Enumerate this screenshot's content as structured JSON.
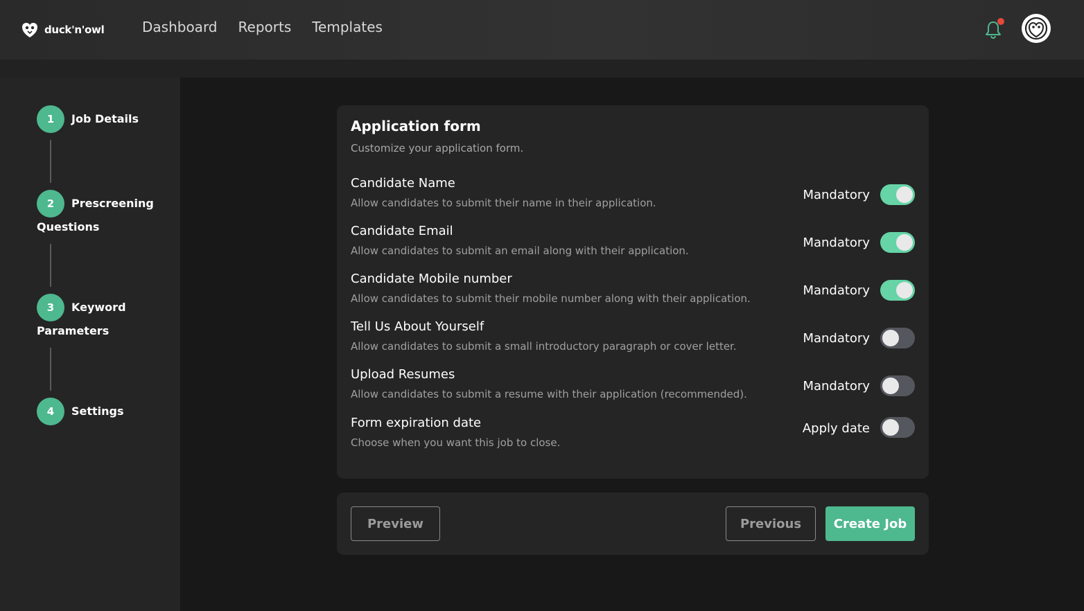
{
  "header": {
    "logo_text": "duck'n'owl",
    "nav": [
      "Dashboard",
      "Reports",
      "Templates"
    ]
  },
  "steps": [
    {
      "number": "1",
      "label": "Job Details"
    },
    {
      "number": "2",
      "label": "Prescreening Questions"
    },
    {
      "number": "3",
      "label": "Keyword Parameters"
    },
    {
      "number": "4",
      "label": "Settings"
    }
  ],
  "form": {
    "title": "Application form",
    "subtitle": "Customize your application form.",
    "fields": [
      {
        "title": "Candidate Name",
        "description": "Allow candidates to submit their name in their application.",
        "option_label": "Mandatory",
        "enabled": true
      },
      {
        "title": "Candidate Email",
        "description": "Allow candidates to submit an email along with their application.",
        "option_label": "Mandatory",
        "enabled": true
      },
      {
        "title": "Candidate Mobile number",
        "description": "Allow candidates to submit their mobile number along with their application.",
        "option_label": "Mandatory",
        "enabled": true
      },
      {
        "title": "Tell Us About Yourself",
        "description": "Allow candidates to submit a small introductory paragraph or cover letter.",
        "option_label": "Mandatory",
        "enabled": false
      },
      {
        "title": "Upload Resumes",
        "description": "Allow candidates to submit a resume with their application (recommended).",
        "option_label": "Mandatory",
        "enabled": false
      },
      {
        "title": "Form expiration date",
        "description": "Choose when you want this job to close.",
        "option_label": "Apply date",
        "enabled": false
      }
    ]
  },
  "actions": {
    "preview": "Preview",
    "previous": "Previous",
    "create": "Create Job"
  },
  "colors": {
    "accent": "#4eb88f",
    "toggle_on": "#66d4a6",
    "toggle_off": "#55575e",
    "notification_dot": "#e5483d"
  },
  "icons": {
    "bell": "bell-icon",
    "logo": "duck-owl-logo-icon",
    "avatar": "user-avatar-icon"
  }
}
